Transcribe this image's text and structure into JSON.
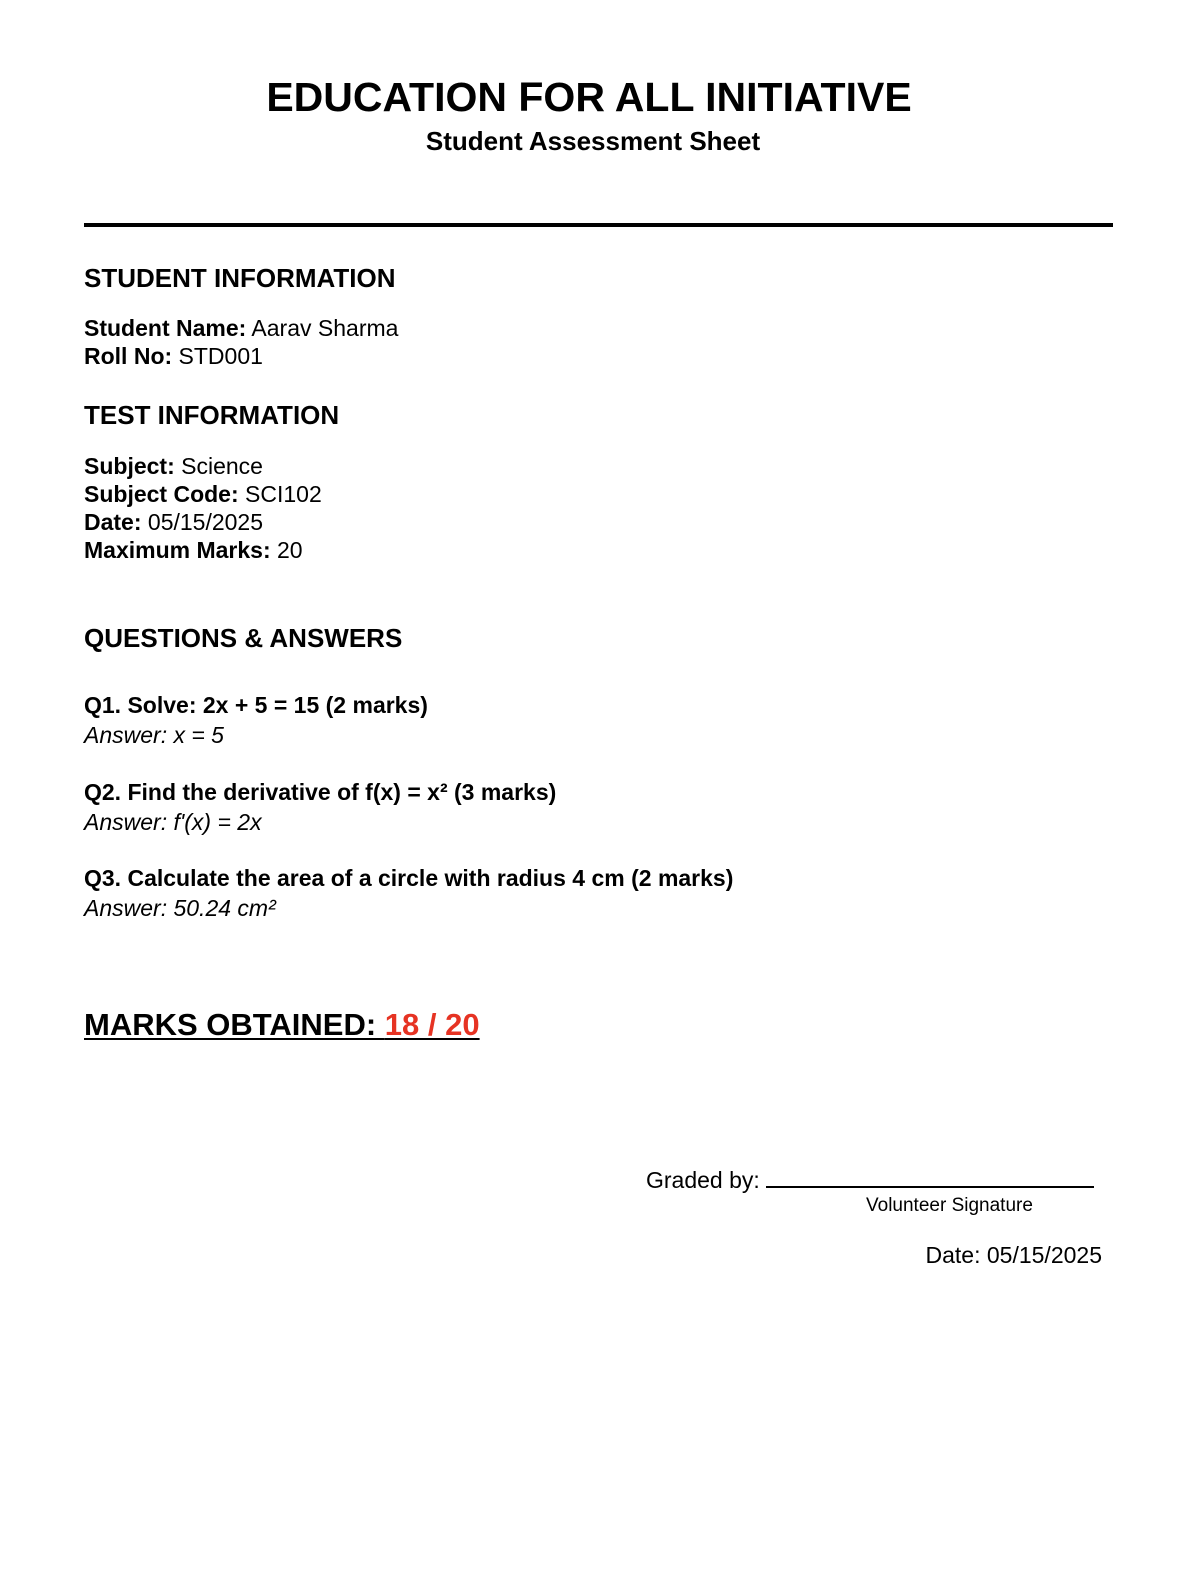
{
  "header": {
    "title": "EDUCATION FOR ALL INITIATIVE",
    "subtitle": "Student Assessment Sheet"
  },
  "student_info": {
    "heading": "STUDENT INFORMATION",
    "fields": [
      {
        "label": "Student Name:",
        "value": "Aarav Sharma"
      },
      {
        "label": "Roll No:",
        "value": "STD001"
      }
    ]
  },
  "test_info": {
    "heading": "TEST INFORMATION",
    "fields": [
      {
        "label": "Subject:",
        "value": "Science"
      },
      {
        "label": "Subject Code:",
        "value": "SCI102"
      },
      {
        "label": "Date:",
        "value": "05/15/2025"
      },
      {
        "label": "Maximum Marks:",
        "value": "20"
      }
    ]
  },
  "qa": {
    "heading": "QUESTIONS & ANSWERS",
    "items": [
      {
        "question": "Q1. Solve: 2x + 5 = 15 (2 marks)",
        "answer": "Answer: x = 5"
      },
      {
        "question": "Q2. Find the derivative of f(x) = x² (3 marks)",
        "answer": "Answer: f'(x) = 2x"
      },
      {
        "question": "Q3. Calculate the area of a circle with radius 4 cm (2 marks)",
        "answer": "Answer: 50.24 cm²"
      }
    ]
  },
  "result": {
    "label": "MARKS OBTAINED: ",
    "score": "18 / 20",
    "score_color": "#e63323"
  },
  "grading": {
    "graded_by_label": "Graded by:",
    "signature_caption": "Volunteer Signature",
    "date_text": "Date: 05/15/2025"
  }
}
